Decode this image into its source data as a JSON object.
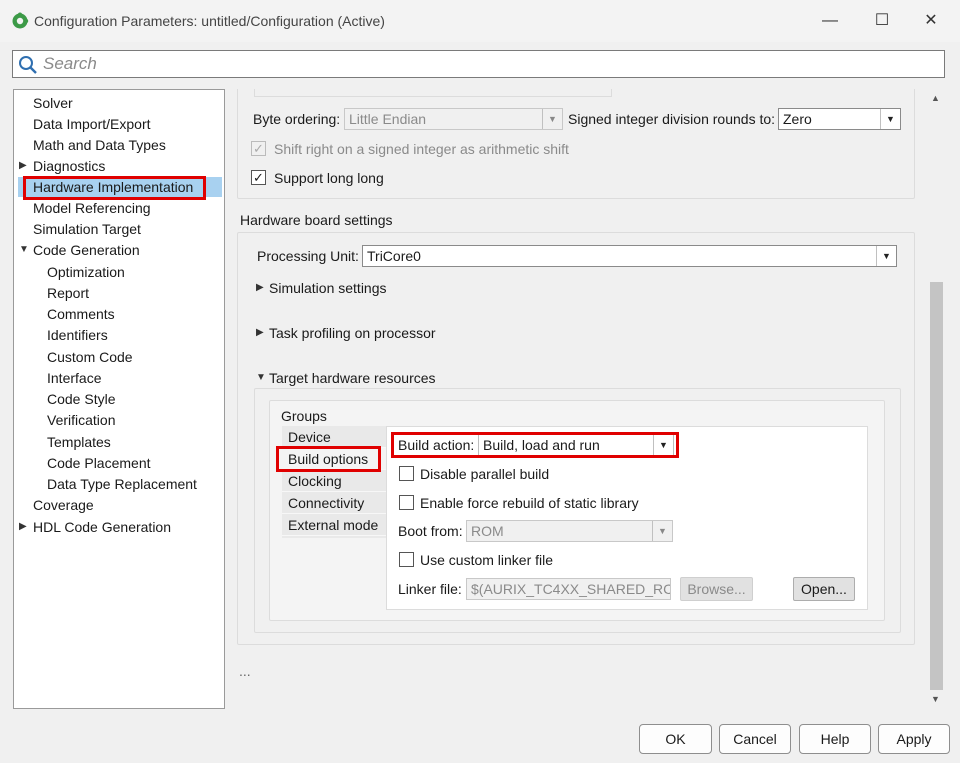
{
  "window": {
    "title": "Configuration Parameters: untitled/Configuration (Active)",
    "minimize": "—",
    "maximize": "☐",
    "close": "✕"
  },
  "search": {
    "placeholder": "Search"
  },
  "tree": {
    "items": [
      {
        "label": "Solver"
      },
      {
        "label": "Data Import/Export"
      },
      {
        "label": "Math and Data Types"
      },
      {
        "label": "Diagnostics"
      },
      {
        "label": "Hardware Implementation"
      },
      {
        "label": "Model Referencing"
      },
      {
        "label": "Simulation Target"
      },
      {
        "label": "Code Generation"
      },
      {
        "label": "Optimization"
      },
      {
        "label": "Report"
      },
      {
        "label": "Comments"
      },
      {
        "label": "Identifiers"
      },
      {
        "label": "Custom Code"
      },
      {
        "label": "Interface"
      },
      {
        "label": "Code Style"
      },
      {
        "label": "Verification"
      },
      {
        "label": "Templates"
      },
      {
        "label": "Code Placement"
      },
      {
        "label": "Data Type Replacement"
      },
      {
        "label": "Coverage"
      },
      {
        "label": "HDL Code Generation"
      }
    ],
    "expand_collapsed": "▶",
    "expand_open": "▼"
  },
  "device_details": {
    "byte_ordering_label": "Byte ordering:",
    "byte_ordering_value": "Little Endian",
    "signed_div_label": "Signed integer division rounds to:",
    "signed_div_value": "Zero",
    "shift_right_label": "Shift right on a signed integer as arithmetic shift",
    "shift_right_checked": "✓",
    "long_long_label": "Support long long",
    "long_long_checked": "✓"
  },
  "board": {
    "heading": "Hardware board settings",
    "processing_unit_label": "Processing Unit:",
    "processing_unit_value": "TriCore0",
    "simulation_settings": "Simulation settings",
    "task_profiling": "Task profiling on processor",
    "target_resources": "Target hardware resources",
    "groups_label": "Groups",
    "groups": [
      "Device",
      "Build options",
      "Clocking",
      "Connectivity",
      "External mode"
    ]
  },
  "build_options": {
    "build_action_label": "Build action:",
    "build_action_value": "Build, load and run",
    "disable_parallel": "Disable parallel build",
    "force_rebuild": "Enable force rebuild of static library",
    "boot_from_label": "Boot from:",
    "boot_from_value": "ROM",
    "custom_linker": "Use custom linker file",
    "linker_file_label": "Linker file:",
    "linker_file_value": "$(AURIX_TC4XX_SHARED_RC",
    "browse": "Browse...",
    "open": "Open..."
  },
  "ellipsis": "...",
  "dialog_buttons": {
    "ok": "OK",
    "cancel": "Cancel",
    "help": "Help",
    "apply": "Apply"
  },
  "colors": {
    "highlight_box": "#e00000",
    "selection": "#a8d1f0"
  }
}
